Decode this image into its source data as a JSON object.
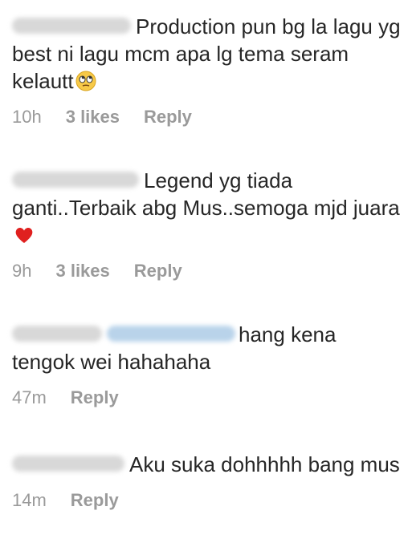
{
  "comments": [
    {
      "text": "Production pun bg la lagu yg best  ni lagu mcm apa lg tema seram kelautt",
      "emoji": "face-with-rolling-eyes",
      "time": "10h",
      "likes": "3 likes",
      "reply": "Reply"
    },
    {
      "text": "Legend yg tiada ganti..Terbaik abg Mus..semoga mjd juara",
      "emoji": "red-heart",
      "time": "9h",
      "likes": "3 likes",
      "reply": "Reply"
    },
    {
      "text": "hang kena tengok wei hahahaha",
      "time": "47m",
      "reply": "Reply"
    },
    {
      "text": "Aku suka dohhhhh bang mus",
      "time": "14m",
      "reply": "Reply"
    }
  ],
  "colors": {
    "text": "#262626",
    "meta": "#9a9a9a",
    "blurred_username": "#d8d8d8",
    "blurred_mention": "#b9d3ea",
    "heart": "#e0201f",
    "emoji_face": "#f7c948"
  }
}
